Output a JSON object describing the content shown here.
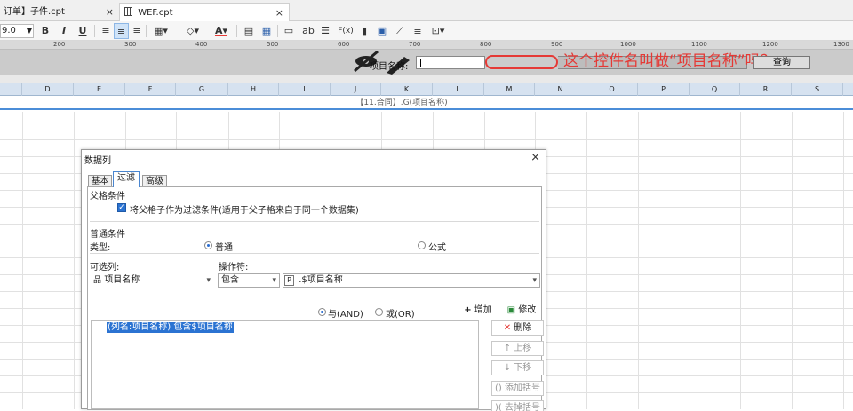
{
  "tabs": [
    {
      "label": "订单】子件.cpt",
      "close": "×"
    },
    {
      "label": "WEF.cpt",
      "close": "×"
    }
  ],
  "toolbar": {
    "zoom": "9.0",
    "bold": "B",
    "italic": "I",
    "underline": "U",
    "text_color": "A",
    "fill": "◇",
    "text_field": "ab",
    "formula": "F(x)"
  },
  "ruler": {
    "ticks": [
      "200",
      "300",
      "400",
      "500",
      "600",
      "700",
      "800",
      "900",
      "1000",
      "1100",
      "1200",
      "1300"
    ]
  },
  "param_bar": {
    "label": "项目名称:",
    "query_button": "查询",
    "annotation": "这个控件名叫做“项目名称”吗？"
  },
  "columns": [
    "D",
    "E",
    "F",
    "G",
    "H",
    "I",
    "J",
    "K",
    "L",
    "M",
    "N",
    "O",
    "P",
    "Q",
    "R",
    "S"
  ],
  "cell": {
    "text": "【11.合同】.G(项目名称)"
  },
  "dialog": {
    "title": "数据列",
    "close": "×",
    "tabs": [
      "基本",
      "过滤",
      "高级"
    ],
    "parent_section": "父格条件",
    "parent_checkbox": "将父格子作为过滤条件(适用于父子格来自于同一个数据集)",
    "normal_section": "普通条件",
    "type_label": "类型:",
    "type_normal": "普通",
    "type_formula": "公式",
    "optional_col_label": "可选列:",
    "operator_label": "操作符:",
    "column_value": "项目名称",
    "operator_value": "包含",
    "param_prefix": "P",
    "param_value": ".$项目名称",
    "and_label": "与(AND)",
    "or_label": "或(OR)",
    "add_button": "增加",
    "modify_button": "修改",
    "condition_item": "(列名:项目名称) 包含$项目名称",
    "delete_button": "删除",
    "up_button": "上移",
    "down_button": "下移",
    "add_bracket_button": "添加括号",
    "remove_bracket_button": "去掉括号"
  }
}
